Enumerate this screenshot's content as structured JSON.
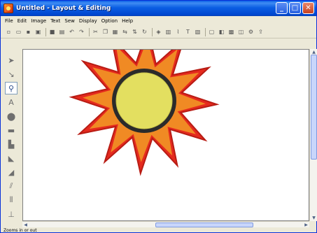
{
  "window": {
    "title": "Untitled - Layout & Editing",
    "controls": [
      "minimize-icon",
      "maximize-icon",
      "close-icon"
    ]
  },
  "menu": {
    "items": [
      "File",
      "Edit",
      "Image",
      "Text",
      "Sew",
      "Display",
      "Option",
      "Help"
    ]
  },
  "toolbar": {
    "groups": [
      [
        "new-icon",
        "open-icon",
        "save-icon",
        "save-as-icon"
      ],
      [
        "stop-icon",
        "import-icon",
        "undo-icon",
        "redo-icon"
      ],
      [
        "cut-icon",
        "copy-icon",
        "paste-icon",
        "mirror-icon",
        "flip-icon",
        "rotate-icon"
      ],
      [
        "color-icon",
        "grid-icon",
        "stitch-icon",
        "text-icon",
        "pattern-icon"
      ],
      [
        "view-icon",
        "preview-icon",
        "design-icon",
        "properties-icon",
        "sew-icon",
        "transfer-icon"
      ]
    ]
  },
  "left_tools": [
    {
      "name": "select-arrow-icon",
      "active": false
    },
    {
      "name": "point-edit-icon",
      "active": false
    },
    {
      "name": "zoom-icon",
      "active": true
    },
    {
      "name": "text-tool-icon",
      "active": false
    },
    {
      "name": "shape-tool-icon",
      "active": false
    },
    {
      "name": "outline-tool-icon",
      "active": false
    },
    {
      "name": "stamp-tool-icon",
      "active": false
    },
    {
      "name": "brush-tool-icon",
      "active": false
    },
    {
      "name": "fill-tool-icon",
      "active": false
    },
    {
      "name": "stitch-tool-icon",
      "active": false
    },
    {
      "name": "measure-tool-icon",
      "active": false
    },
    {
      "name": "settings-tool-icon",
      "active": false
    }
  ],
  "design": {
    "outer_color": "#e52a1e",
    "inner_color": "#f08a24",
    "ring_color": "#2b2b2b",
    "center_color": "#e3df60"
  },
  "status": {
    "text": "Zooms in or out"
  }
}
